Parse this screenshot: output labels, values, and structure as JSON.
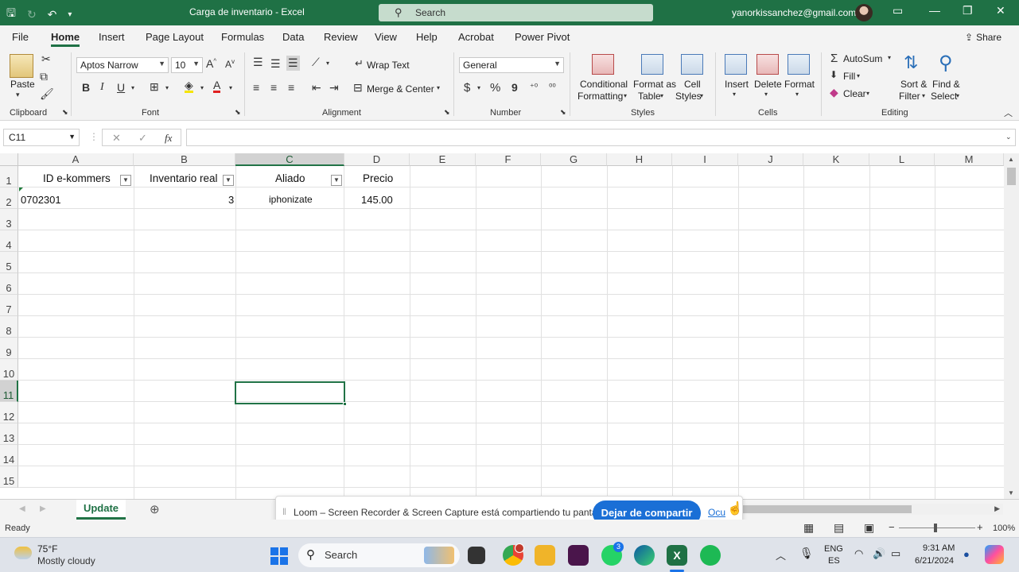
{
  "window": {
    "title": "Carga de inventario  -  Excel",
    "search_placeholder": "Search",
    "account_email": "yanorkissanchez@gmail.com"
  },
  "icons": {
    "save": "floppy-disk-icon",
    "undo": "undo-icon",
    "redo": "redo-icon",
    "customize": "chevron-down-icon",
    "minimize": "minimize-icon",
    "restore": "restore-icon",
    "close": "close-icon",
    "search": "magnifier-icon"
  },
  "tabs": [
    "File",
    "Home",
    "Insert",
    "Page Layout",
    "Formulas",
    "Data",
    "Review",
    "View",
    "Help",
    "Acrobat",
    "Power Pivot"
  ],
  "active_tab": "Home",
  "share_label": "Share",
  "ribbon": {
    "clipboard": {
      "paste": "Paste",
      "group": "Clipboard"
    },
    "font": {
      "name": "Aptos Narrow",
      "size": "10",
      "bold": "B",
      "italic": "I",
      "underline": "U",
      "group": "Font"
    },
    "alignment": {
      "wrap": "Wrap Text",
      "merge": "Merge & Center",
      "group": "Alignment"
    },
    "number": {
      "format": "General",
      "currency": "$",
      "percent": "%",
      "comma": "9",
      "group": "Number"
    },
    "styles": {
      "conditional1": "Conditional",
      "conditional2": "Formatting",
      "table1": "Format as",
      "table2": "Table",
      "cell1": "Cell",
      "cell2": "Styles",
      "group": "Styles"
    },
    "cells": {
      "insert": "Insert",
      "delete": "Delete",
      "format": "Format",
      "group": "Cells"
    },
    "editing": {
      "autosum": "AutoSum",
      "fill": "Fill",
      "clear": "Clear",
      "sort1": "Sort &",
      "sort2": "Filter",
      "find1": "Find &",
      "find2": "Select",
      "group": "Editing"
    }
  },
  "formula_bar": {
    "name_box": "C11",
    "fx": "fx",
    "cancel": "✕",
    "enter": "✓",
    "value": ""
  },
  "grid": {
    "columns": [
      "A",
      "B",
      "C",
      "D",
      "E",
      "F",
      "G",
      "H",
      "I",
      "J",
      "K",
      "L",
      "M"
    ],
    "rows": [
      "1",
      "2",
      "3",
      "4",
      "5",
      "6",
      "7",
      "8",
      "9",
      "10",
      "11",
      "12",
      "13",
      "14",
      "15"
    ],
    "headers": {
      "a": "ID e-kommers",
      "b": "Inventario real",
      "c": "Aliado",
      "d": "Precio"
    },
    "row2": {
      "a": "0702301",
      "b": "3",
      "c": "iphonizate",
      "d": "145.00"
    },
    "selected_cell": "C11"
  },
  "sheet_tab": "Update",
  "loom": {
    "message": "Loom – Screen Recorder & Screen Capture está compartiendo tu pantalla.",
    "stop_button": "Dejar de compartir",
    "hide_link": "Ocu"
  },
  "status": {
    "ready": "Ready",
    "zoom": "100%"
  },
  "taskbar": {
    "temp": "75°F",
    "weather": "Mostly cloudy",
    "search": "Search",
    "language1": "ENG",
    "language2": "ES",
    "time": "9:31 AM",
    "date": "6/21/2024",
    "whatsapp_badge": "3"
  }
}
